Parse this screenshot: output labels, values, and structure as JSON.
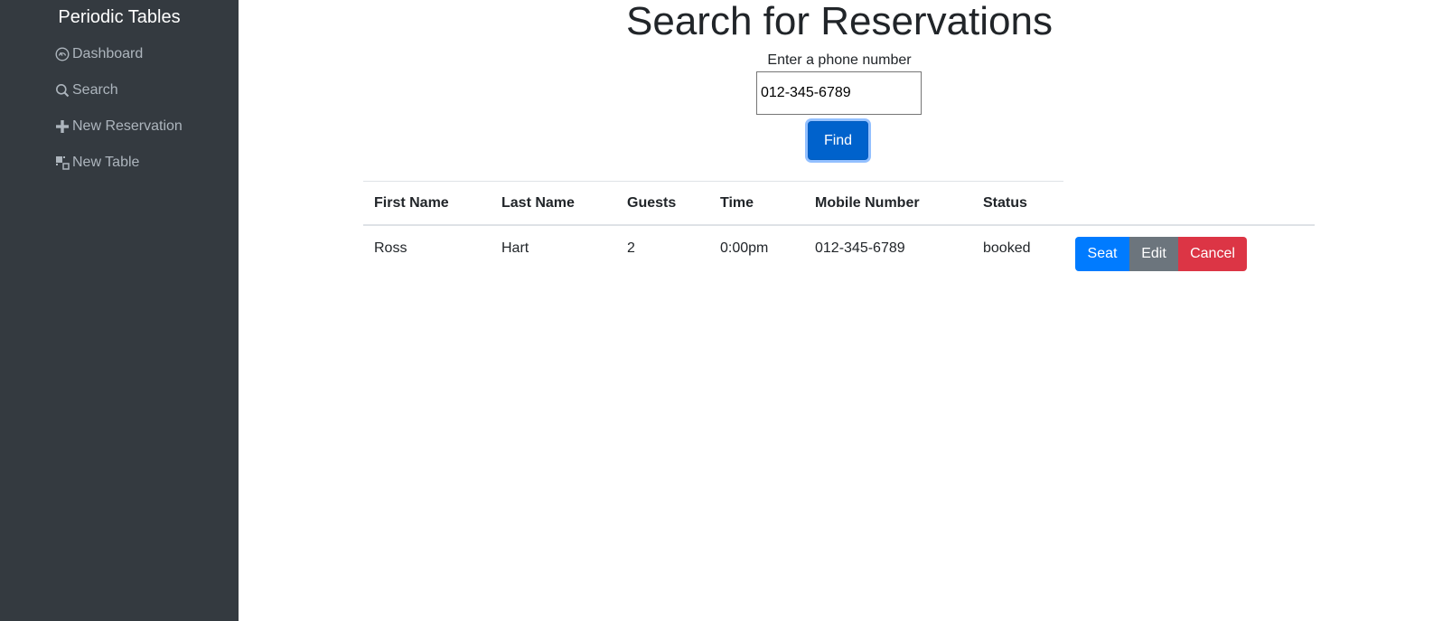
{
  "sidebar": {
    "brand": "Periodic Tables",
    "items": [
      {
        "label": "Dashboard",
        "icon": "dashboard-icon"
      },
      {
        "label": "Search",
        "icon": "search-icon"
      },
      {
        "label": "New Reservation",
        "icon": "plus-icon"
      },
      {
        "label": "New Table",
        "icon": "new-table-icon"
      }
    ]
  },
  "main": {
    "title": "Search for Reservations",
    "search": {
      "label": "Enter a phone number",
      "value": "012-345-6789",
      "button": "Find"
    },
    "table": {
      "headers": [
        "First Name",
        "Last Name",
        "Guests",
        "Time",
        "Mobile Number",
        "Status"
      ],
      "rows": [
        {
          "first_name": "Ross",
          "last_name": "Hart",
          "guests": "2",
          "time": "0:00pm",
          "mobile": "012-345-6789",
          "status": "booked",
          "actions": {
            "seat": "Seat",
            "edit": "Edit",
            "cancel": "Cancel"
          }
        }
      ]
    }
  },
  "colors": {
    "sidebar_bg": "#343a40",
    "nav_text": "#adb5bd",
    "primary": "#007bff",
    "secondary": "#6c757d",
    "danger": "#dc3545"
  }
}
